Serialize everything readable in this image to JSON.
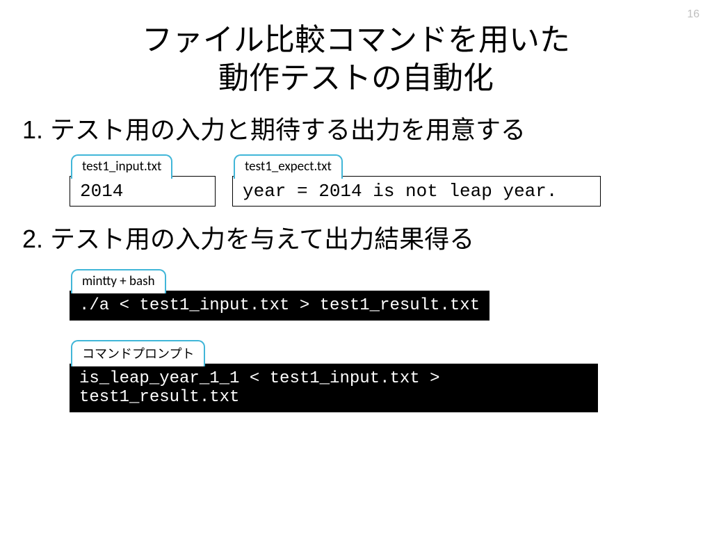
{
  "page_number": "16",
  "title_line1": "ファイル比較コマンドを用いた",
  "title_line2": "動作テストの自動化",
  "step1": "1. テスト用の入力と期待する出力を用意する",
  "file1": {
    "label": "test1_input.txt",
    "content": "2014"
  },
  "file2": {
    "label": "test1_expect.txt",
    "content": "year = 2014 is not leap year."
  },
  "step2": "2. テスト用の入力を与えて出力結果得る",
  "cmd1": {
    "label": "mintty + bash",
    "line": "./a < test1_input.txt > test1_result.txt"
  },
  "cmd2": {
    "label": "コマンドプロンプト",
    "line": "is_leap_year_1_1 < test1_input.txt > test1_result.txt"
  }
}
